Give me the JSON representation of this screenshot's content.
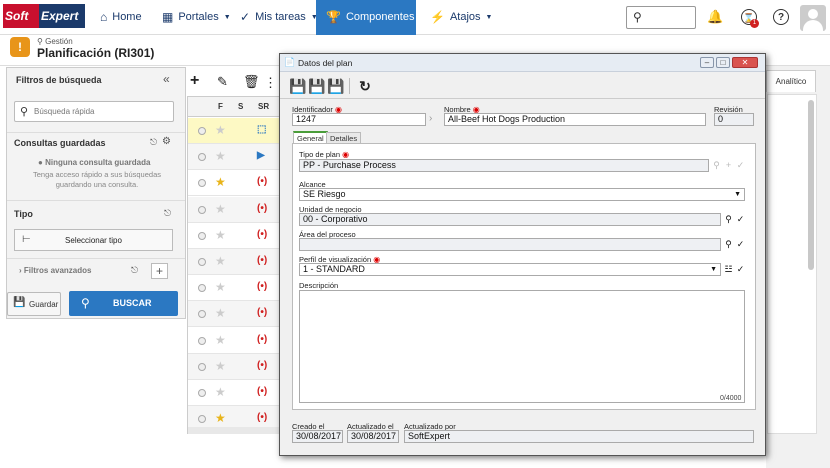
{
  "nav": {
    "logo_part1": "Soft",
    "logo_part2": "Expert",
    "items": [
      {
        "label": "Home"
      },
      {
        "label": "Portales"
      },
      {
        "label": "Mis tareas"
      },
      {
        "label": "Componentes"
      },
      {
        "label": "Atajos"
      }
    ],
    "notif_badge": "1"
  },
  "header": {
    "breadcrumb": "Gestión",
    "title": "Planificación (RI301)"
  },
  "left": {
    "filters_title": "Filtros de búsqueda",
    "quick_search_placeholder": "Búsqueda rápida",
    "saved_title": "Consultas guardadas",
    "saved_empty": "Ninguna consulta guardada",
    "saved_hint_1": "Tenga acceso rápido a sus búsquedas",
    "saved_hint_2": "guardando una consulta.",
    "type_title": "Tipo",
    "select_type": "Seleccionar tipo",
    "advanced": "Filtros avanzados",
    "save_btn": "Guardar",
    "search_btn": "BUSCAR"
  },
  "grid": {
    "headers": [
      "F",
      "S",
      "SR"
    ],
    "rows": [
      {
        "fav": false,
        "selected": true
      },
      {
        "fav": false
      },
      {
        "fav": true
      },
      {
        "fav": false
      },
      {
        "fav": false
      },
      {
        "fav": false
      },
      {
        "fav": false
      },
      {
        "fav": false
      },
      {
        "fav": false
      },
      {
        "fav": false
      },
      {
        "fav": false
      },
      {
        "fav": true
      }
    ]
  },
  "right": {
    "tab": "Analítico"
  },
  "dialog": {
    "title": "Datos del plan",
    "id_label": "Identificador",
    "id_value": "1247",
    "name_label": "Nombre",
    "name_value": "All-Beef Hot Dogs Production",
    "rev_label": "Revisión",
    "rev_value": "0",
    "tab_general": "General",
    "tab_details": "Detalles",
    "plan_type_label": "Tipo de plan",
    "plan_type_value": "PP - Purchase Process",
    "scope_label": "Alcance",
    "scope_value": "SE Riesgo",
    "bu_label": "Unidad de negocio",
    "bu_value": "00 - Corporativo",
    "area_label": "Área del proceso",
    "area_value": "",
    "profile_label": "Perfil de visualización",
    "profile_value": "1 - STANDARD",
    "desc_label": "Descripción",
    "desc_counter": "0/4000",
    "created_label": "Creado el",
    "created_value": "30/08/2017",
    "updated_label": "Actualizado el",
    "updated_value": "30/08/2017",
    "updated_by_label": "Actualizado por",
    "updated_by_value": "SoftExpert"
  }
}
